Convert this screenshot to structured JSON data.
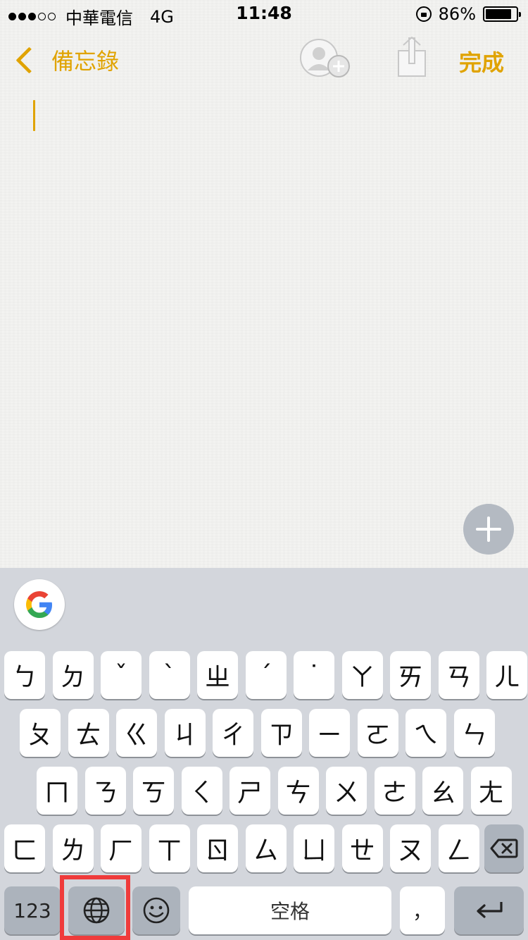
{
  "status_bar": {
    "carrier": "中華電信",
    "network": "4G",
    "time": "11:48",
    "battery_text": "86%",
    "battery_level": 0.86,
    "signal_dots": [
      true,
      true,
      true,
      false,
      false
    ]
  },
  "nav": {
    "back_label": "備忘錄",
    "done_label": "完成",
    "accent_color": "#e0a300"
  },
  "keyboard": {
    "row1": [
      "ㄅ",
      "ㄉ",
      "ˇ",
      "ˋ",
      "ㄓ",
      "ˊ",
      "˙",
      "ㄚ",
      "ㄞ",
      "ㄢ",
      "ㄦ"
    ],
    "row2": [
      "ㄆ",
      "ㄊ",
      "ㄍ",
      "ㄐ",
      "ㄔ",
      "ㄗ",
      "ㄧ",
      "ㄛ",
      "ㄟ",
      "ㄣ"
    ],
    "row3": [
      "ㄇ",
      "ㄋ",
      "ㄎ",
      "ㄑ",
      "ㄕ",
      "ㄘ",
      "ㄨ",
      "ㄜ",
      "ㄠ",
      "ㄤ"
    ],
    "row4": [
      "ㄈ",
      "ㄌ",
      "ㄏ",
      "ㄒ",
      "ㄖ",
      "ㄙ",
      "ㄩ",
      "ㄝ",
      "ㄡ",
      "ㄥ"
    ],
    "numbers_label": "123",
    "space_label": "空格",
    "comma_label": "，",
    "icons": {
      "google": "google-icon",
      "globe": "globe-icon",
      "emoji": "emoji-icon",
      "delete": "delete-icon",
      "return": "return-icon"
    }
  },
  "highlight_color": "#ef3b3b"
}
